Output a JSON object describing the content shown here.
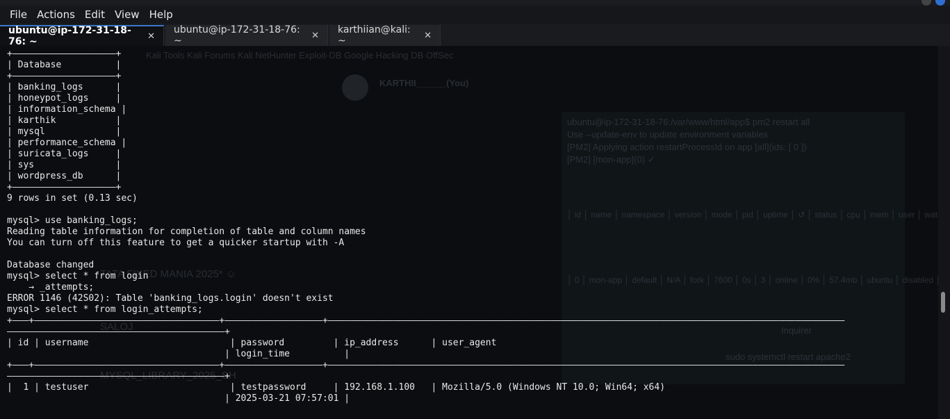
{
  "menubar": {
    "items": [
      "File",
      "Actions",
      "Edit",
      "View",
      "Help"
    ]
  },
  "tabs": [
    {
      "label": "ubuntu@ip-172-31-18-76: ~",
      "close": "✕",
      "active": true
    },
    {
      "label": "ubuntu@ip-172-31-18-76: ~",
      "close": "✕",
      "active": false
    },
    {
      "label": "karthiian@kali: ~",
      "close": "✕",
      "active": false
    }
  ],
  "terminal": {
    "lines": [
      "+———————————————————+",
      "| Database          |",
      "+———————————————————+",
      "| banking_logs      |",
      "| honeypot_logs     |",
      "| information_schema |",
      "| karthik           |",
      "| mysql             |",
      "| performance_schema |",
      "| suricata_logs     |",
      "| sys               |",
      "| wordpress_db      |",
      "+———————————————————+",
      "9 rows in set (0.13 sec)",
      "",
      "mysql> use banking_logs;",
      "Reading table information for completion of table and column names",
      "You can turn off this feature to get a quicker startup with -A",
      "",
      "Database changed",
      "mysql> select * from login",
      "    → _attempts;",
      "ERROR 1146 (42S02): Table 'banking_logs.login' doesn't exist",
      "mysql> select * from login_attempts;",
      "+———+——————————————————————————————————+——————————————————+———————————————————————————————————————————————————————————————————————————————————————————————",
      "————————————————————————————————————————+",
      "| id | username                          | password         | ip_address      | user_agent",
      "                                        | login_time          |",
      "+———+——————————————————————————————————+——————————————————+———————————————————————————————————————————————————————————————————————————————————————————————",
      "————————————————————————————————————————+",
      "|  1 | testuser                          | testpassword     | 192.168.1.100   | Mozilla/5.0 (Windows NT 10.0; Win64; x64)",
      "                                        | 2025-03-21 07:57:01 |"
    ]
  },
  "background_ghost": {
    "name": "KARTHII______(You)",
    "bookmarks": "Kali Tools   Kali Forums   Kali NetHunter   Exploit-DB   Google Hacking DB   OffSec",
    "cmd": "ubuntu@ip-172-31-18-76:/var/www/html/app$ pm2 restart all",
    "pm2_note": "Use --update-env to update environment variables",
    "pm2_apply": "[PM2] Applying action restartProcessId on app [all](ids: [ 0 ])",
    "pm2_done": "[PM2] [mon-app](0) ✓",
    "pm2_header": "│ id │ name   │ namespace │ version │ mode │ pid │ uptime │ ↺ │ status │ cpu │ mem │ user │ watching │",
    "pm2_row": "│ 0 │ mon-app │ default │ N/A │ fork │ 7600 │ 0s │ 3 │ online │ 0% │ 57.4mb │ ubuntu │ disabled │",
    "chat_1": "TATA FIXED MANIA 2025* ☺",
    "chat_2": "SALOJ",
    "chat_3": "MYSQL_LIBRARY_2025_SH",
    "chat_4": "sudo systemctl restart apache2",
    "chat_5": "Inquirer"
  },
  "colors": {
    "background": "#0c0d10",
    "text": "#e9e9e9",
    "tab_active_accent": "#3a78c9"
  }
}
